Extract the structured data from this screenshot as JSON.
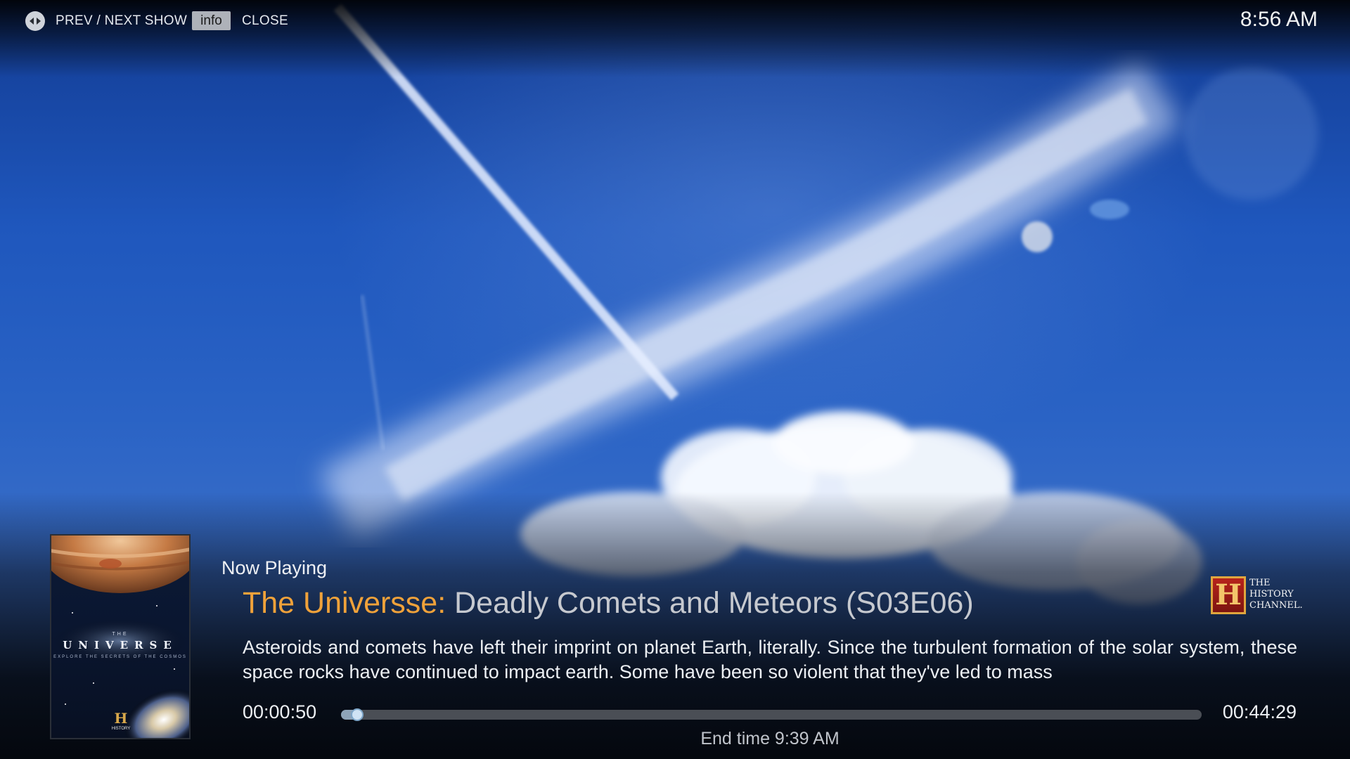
{
  "topbar": {
    "prev_next_label": "PREV / NEXT SHOW",
    "info_label": "info",
    "close_label": "CLOSE",
    "clock": "8:56 AM"
  },
  "now_playing": {
    "heading": "Now Playing",
    "show_title": "The Universse:",
    "episode_title": "Deadly Comets and Meteors (S03E06)",
    "plot": "Asteroids and comets have left their imprint on planet Earth, literally. Since the turbulent formation of the solar system, these space rocks have continued to impact earth. Some have been so violent that they've led to mass",
    "poster": {
      "the": "THE",
      "title": "UNIVERSE",
      "subtitle": "EXPLORE THE SECRETS OF THE COSMOS",
      "logo_letter": "H",
      "logo_text": "HISTORY"
    },
    "channel": {
      "letter": "H",
      "line1": "THE",
      "line2": "HISTORY",
      "line3": "CHANNEL."
    }
  },
  "playback": {
    "elapsed": "00:00:50",
    "total": "00:44:29",
    "progress": 0.019,
    "end_time": "End time 9:39 AM"
  },
  "colors": {
    "show_title": "#f0a23a",
    "episode_title": "#c6c9cf",
    "progress_track": "#4a4e55"
  }
}
